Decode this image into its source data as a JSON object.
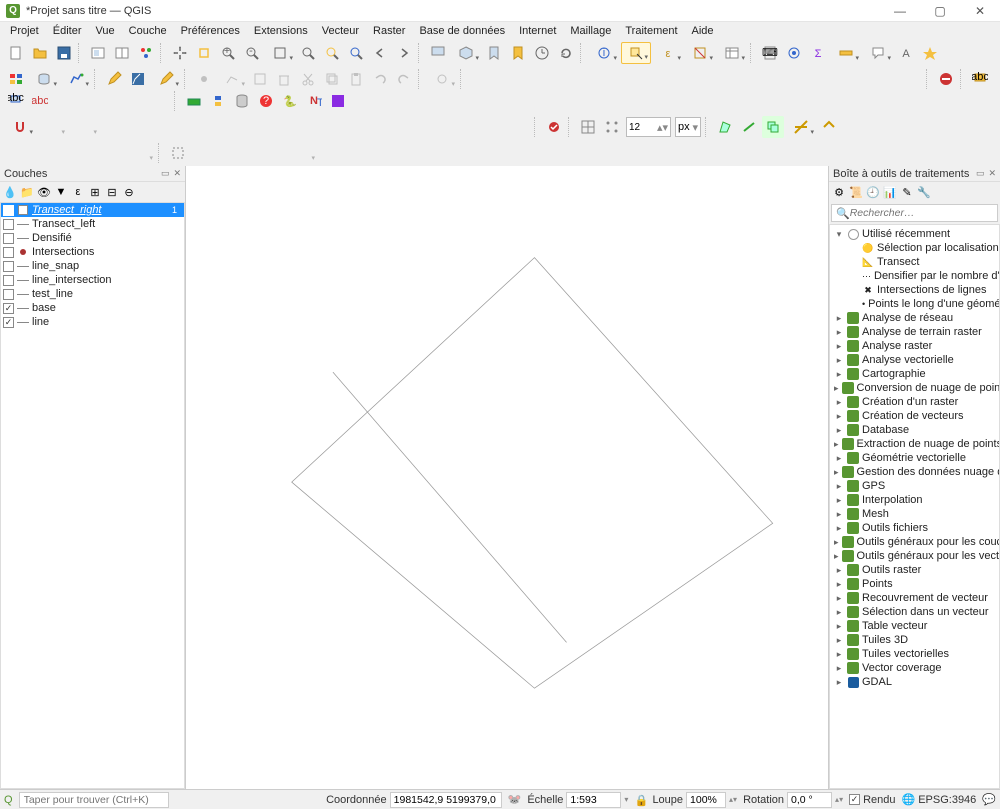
{
  "titlebar": {
    "title": "*Projet sans titre — QGIS"
  },
  "menubar": [
    "Projet",
    "Éditer",
    "Vue",
    "Couche",
    "Préférences",
    "Extensions",
    "Vecteur",
    "Raster",
    "Base de données",
    "Internet",
    "Maillage",
    "Traitement",
    "Aide"
  ],
  "snapping": {
    "value": "12",
    "unit": "px"
  },
  "layers_panel": {
    "title": "Couches",
    "items": [
      {
        "checked": false,
        "symbol": "square-white",
        "name": "Transect_right",
        "italic": true,
        "selected": true,
        "count": "1"
      },
      {
        "checked": false,
        "symbol": "line-gray",
        "name": "Transect_left"
      },
      {
        "checked": false,
        "symbol": "line-gray",
        "name": "Densifié"
      },
      {
        "checked": false,
        "symbol": "point-red",
        "name": "Intersections"
      },
      {
        "checked": false,
        "symbol": "line-gray",
        "name": "line_snap"
      },
      {
        "checked": false,
        "symbol": "line-gray",
        "name": "line_intersection"
      },
      {
        "checked": false,
        "symbol": "line-gray",
        "name": "test_line"
      },
      {
        "checked": true,
        "symbol": "line-gray",
        "name": "base"
      },
      {
        "checked": true,
        "symbol": "line-gray",
        "name": "line"
      }
    ]
  },
  "processing_panel": {
    "title": "Boîte à outils de traitements",
    "search_placeholder": "Rechercher…",
    "recent": {
      "label": "Utilisé récemment",
      "items": [
        {
          "icon": "select",
          "label": "Sélection par localisation"
        },
        {
          "icon": "transect",
          "label": "Transect"
        },
        {
          "icon": "densify",
          "label": "Densifier par le nombre d'intervalles"
        },
        {
          "icon": "intersect",
          "label": "Intersections de lignes"
        },
        {
          "icon": "points",
          "label": "Points le long d'une géométrie"
        }
      ]
    },
    "groups": [
      "Analyse de réseau",
      "Analyse de terrain raster",
      "Analyse raster",
      "Analyse vectorielle",
      "Cartographie",
      "Conversion de nuage de points",
      "Création d'un raster",
      "Création de vecteurs",
      "Database",
      "Extraction de nuage de points",
      "Géométrie vectorielle",
      "Gestion des données nuage de points",
      "GPS",
      "Interpolation",
      "Mesh",
      "Outils fichiers",
      "Outils généraux pour les couches",
      "Outils généraux pour les vecteurs",
      "Outils raster",
      "Points",
      "Recouvrement de vecteur",
      "Sélection dans un vecteur",
      "Table vecteur",
      "Tuiles 3D",
      "Tuiles vectorielles",
      "Vector coverage",
      "GDAL"
    ]
  },
  "statusbar": {
    "locator_placeholder": "Taper pour trouver (Ctrl+K)",
    "coord_label": "Coordonnée",
    "coord_value": "1981542,9 5199379,0",
    "scale_label": "Échelle",
    "scale_value": "1:593",
    "magnifier_label": "Loupe",
    "magnifier_value": "100%",
    "rotation_label": "Rotation",
    "rotation_value": "0,0 °",
    "render_label": "Rendu",
    "crs_label": "EPSG:3946"
  }
}
